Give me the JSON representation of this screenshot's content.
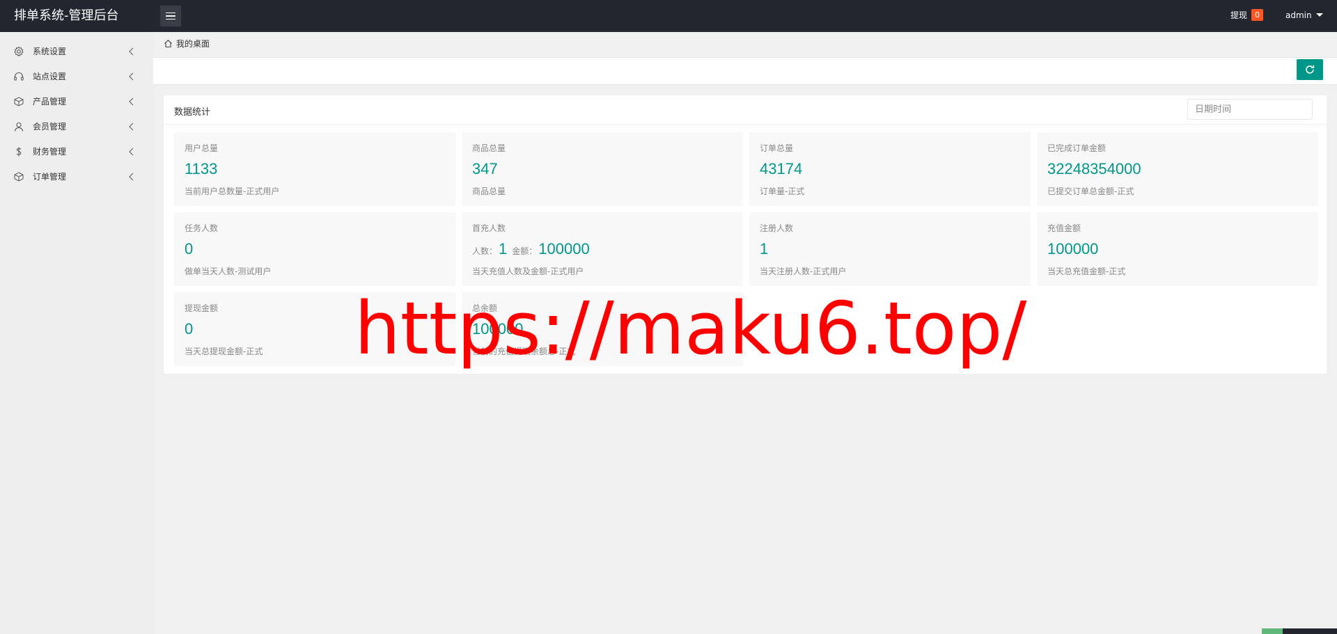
{
  "header": {
    "title": "排单系统-管理后台",
    "withdraw_label": "提现",
    "withdraw_count": "0",
    "user_name": "admin"
  },
  "sidebar": {
    "items": [
      {
        "label": "系统设置",
        "icon": "gear-icon"
      },
      {
        "label": "站点设置",
        "icon": "headset-icon"
      },
      {
        "label": "产品管理",
        "icon": "box-icon"
      },
      {
        "label": "会员管理",
        "icon": "user-icon"
      },
      {
        "label": "财务管理",
        "icon": "dollar-icon"
      },
      {
        "label": "订单管理",
        "icon": "box-icon"
      }
    ]
  },
  "breadcrumb": {
    "label": "我的桌面"
  },
  "stats_card": {
    "title": "数据统计",
    "date_placeholder": "日期时间",
    "items": [
      {
        "label": "用户总量",
        "value": "1133",
        "desc": "当前用户总数量-正式用户"
      },
      {
        "label": "商品总量",
        "value": "347",
        "desc": "商品总量"
      },
      {
        "label": "订单总量",
        "value": "43174",
        "desc": "订单量-正式"
      },
      {
        "label": "已完成订单金额",
        "value": "32248354000",
        "desc": "已提交订单总金额-正式"
      },
      {
        "label": "任务人数",
        "value": "0",
        "desc": "做单当天人数-测试用户"
      },
      {
        "label": "首充人数",
        "people_prefix": "人数：",
        "people_value": "1",
        "amount_prefix": "金额：",
        "amount_value": "100000",
        "desc": "当天充值人数及金额-正式用户"
      },
      {
        "label": "注册人数",
        "value": "1",
        "desc": "当天注册人数-正式用户"
      },
      {
        "label": "充值金额",
        "value": "100000",
        "desc": "当天总充值金额-正式"
      },
      {
        "label": "提现金额",
        "value": "0",
        "desc": "当天总提现金额-正式"
      },
      {
        "label": "总余额",
        "value": "100000",
        "desc": "当前的充值提现余额总-正式"
      }
    ]
  },
  "watermark": "https://maku6.top/",
  "colors": {
    "accent": "#009688",
    "header_bg": "#23262e",
    "badge": "#ff5722",
    "watermark": "#ff0000"
  }
}
